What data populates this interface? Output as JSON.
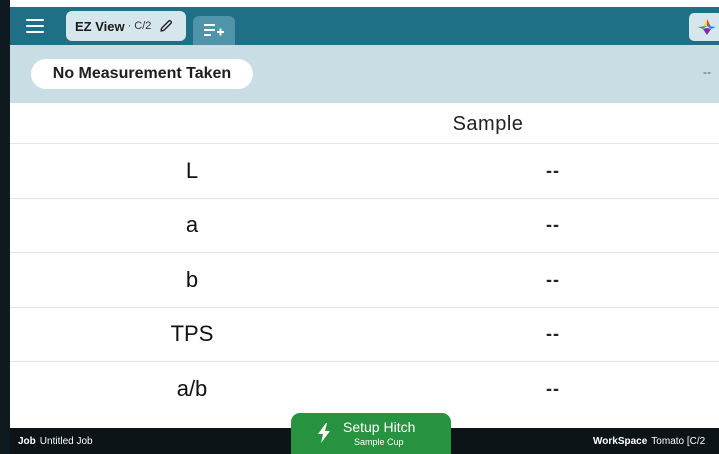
{
  "header": {
    "tab_title": "EZ View",
    "tab_separator": "·",
    "tab_subtitle": "C/2"
  },
  "status": {
    "message": "No Measurement Taken",
    "value": "--"
  },
  "table": {
    "column_header": "Sample",
    "rows": [
      {
        "label": "L",
        "value": "--"
      },
      {
        "label": "a",
        "value": "--"
      },
      {
        "label": "b",
        "value": "--"
      },
      {
        "label": "TPS",
        "value": "--"
      },
      {
        "label": "a/b",
        "value": "--"
      }
    ]
  },
  "action_button": {
    "title": "Setup Hitch",
    "subtitle": "Sample Cup"
  },
  "footer": {
    "job_label": "Job",
    "job_value": "Untitled Job",
    "workspace_label": "WorkSpace",
    "workspace_value": "Tomato [C/2"
  },
  "colors": {
    "topbar": "#1f6f86",
    "status_band": "#c9dee4",
    "action_green": "#27923f",
    "footer": "#0c1418"
  }
}
